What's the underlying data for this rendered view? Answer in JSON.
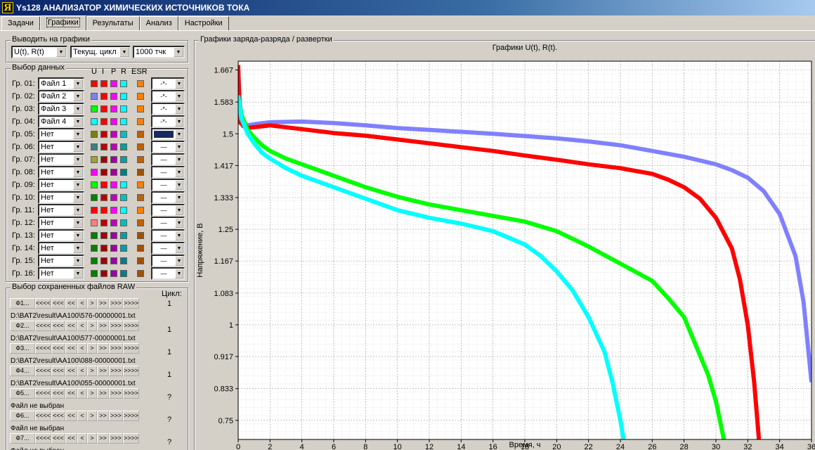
{
  "window": {
    "title": "Ys128 АНАЛИЗАТОР ХИМИЧЕСКИХ ИСТОЧНИКОВ ТОКА",
    "icon": "Я"
  },
  "tabs": [
    "Задачи",
    "Графики",
    "Результаты",
    "Анализ",
    "Настройки"
  ],
  "output": {
    "title": "Выводить на графики",
    "mode": "U(t), R(t)",
    "cycle": "Текущ. цикл",
    "points": "1000 тчк"
  },
  "data_select": {
    "title": "Выбор данных",
    "headers": [
      "U",
      "I",
      "P",
      "R",
      "ESR"
    ],
    "rows": [
      {
        "label": "Гр. 01:",
        "file": "Файл 1",
        "colors": [
          "#ff0000",
          "#ff0000",
          "#ff00ff",
          "#00ffff",
          "#ff8000"
        ],
        "style": "-*-"
      },
      {
        "label": "Гр. 02:",
        "file": "Файл 2",
        "colors": [
          "#8080ff",
          "#ff0000",
          "#ff00ff",
          "#00ffff",
          "#ff8000"
        ],
        "style": "-*-"
      },
      {
        "label": "Гр. 03:",
        "file": "Файл 3",
        "colors": [
          "#00ff00",
          "#ff0000",
          "#ff00ff",
          "#00ffff",
          "#ff8000"
        ],
        "style": "-*-"
      },
      {
        "label": "Гр. 04:",
        "file": "Файл 4",
        "colors": [
          "#00ffff",
          "#ff0000",
          "#ff00ff",
          "#00ffff",
          "#ff8000"
        ],
        "style": "-*-"
      },
      {
        "label": "Гр. 05:",
        "file": "Нет",
        "colors": [
          "#808000",
          "#c00000",
          "#c000c0",
          "#00c0c0",
          "#c06000"
        ],
        "style": "solid"
      },
      {
        "label": "Гр. 06:",
        "file": "Нет",
        "colors": [
          "#408080",
          "#c00000",
          "#c000c0",
          "#00a0a0",
          "#c06000"
        ],
        "style": "—"
      },
      {
        "label": "Гр. 07:",
        "file": "Нет",
        "colors": [
          "#a0a040",
          "#a00000",
          "#a000a0",
          "#00a0a0",
          "#c06000"
        ],
        "style": "—"
      },
      {
        "label": "Гр. 08:",
        "file": "Нет",
        "colors": [
          "#ff00ff",
          "#a00000",
          "#a000a0",
          "#008080",
          "#a05000"
        ],
        "style": "—"
      },
      {
        "label": "Гр. 09:",
        "file": "Нет",
        "colors": [
          "#00ff00",
          "#ff0000",
          "#ff00ff",
          "#00ffff",
          "#ff8000"
        ],
        "style": "—"
      },
      {
        "label": "Гр. 10:",
        "file": "Нет",
        "colors": [
          "#008000",
          "#c00000",
          "#c000c0",
          "#00c0c0",
          "#c06000"
        ],
        "style": "—"
      },
      {
        "label": "Гр. 11:",
        "file": "Нет",
        "colors": [
          "#ff0000",
          "#ff0000",
          "#ff00ff",
          "#00ffff",
          "#ff8000"
        ],
        "style": "—"
      },
      {
        "label": "Гр. 12:",
        "file": "Нет",
        "colors": [
          "#ff8080",
          "#c00000",
          "#c000c0",
          "#00c0c0",
          "#c06000"
        ],
        "style": "—"
      },
      {
        "label": "Гр. 13:",
        "file": "Нет",
        "colors": [
          "#008000",
          "#a00000",
          "#a000a0",
          "#00a0a0",
          "#a05000"
        ],
        "style": "—"
      },
      {
        "label": "Гр. 14:",
        "file": "Нет",
        "colors": [
          "#008000",
          "#a00000",
          "#a000a0",
          "#00a0a0",
          "#a05000"
        ],
        "style": "—"
      },
      {
        "label": "Гр. 15:",
        "file": "Нет",
        "colors": [
          "#008000",
          "#a00000",
          "#a000a0",
          "#008080",
          "#a05000"
        ],
        "style": "—"
      },
      {
        "label": "Гр. 16:",
        "file": "Нет",
        "colors": [
          "#008000",
          "#a00000",
          "#a000a0",
          "#008080",
          "#a05000"
        ],
        "style": "—"
      }
    ]
  },
  "raw_files": {
    "title": "Выбор сохраненных файлов RAW",
    "cycle_header": "Цикл:",
    "nav": [
      "<<<<",
      "<<<",
      "<<",
      "<",
      ">",
      ">>",
      ">>>",
      ">>>>"
    ],
    "files": [
      {
        "name": "Ф1...",
        "path": "D:\\BAT2\\result\\AA100\\576-00000001.txt",
        "cycle": "1"
      },
      {
        "name": "Ф2...",
        "path": "D:\\BAT2\\result\\AA100\\577-00000001.txt",
        "cycle": "1"
      },
      {
        "name": "Ф3...",
        "path": "D:\\BAT2\\result\\AA100\\088-00000001.txt",
        "cycle": "1"
      },
      {
        "name": "Ф4...",
        "path": "D:\\BAT2\\result\\AA100\\055-00000001.txt",
        "cycle": "1"
      },
      {
        "name": "Ф5...",
        "path": "Файл не выбран",
        "cycle": "?"
      },
      {
        "name": "Ф6...",
        "path": "Файл не выбран",
        "cycle": "?"
      },
      {
        "name": "Ф7...",
        "path": "Файл не выбран",
        "cycle": "?"
      }
    ]
  },
  "chart_panel": {
    "title": "Графики заряда-разряда / развертки"
  },
  "chart_data": {
    "type": "line",
    "title": "Графики U(t), R(t).",
    "xlabel": "Время, ч",
    "ylabel": "Напряжение, В",
    "xlim": [
      0,
      36
    ],
    "ylim": [
      0.7,
      1.69
    ],
    "xticks": [
      0,
      2,
      4,
      6,
      8,
      10,
      12,
      14,
      16,
      18,
      20,
      22,
      24,
      26,
      28,
      30,
      32,
      34,
      36
    ],
    "yticks": [
      {
        "v": 1.667,
        "label": "1.667"
      },
      {
        "v": 1.583,
        "label": "1.583"
      },
      {
        "v": 1.5,
        "label": "1.5"
      },
      {
        "v": 1.417,
        "label": "1.417"
      },
      {
        "v": 1.333,
        "label": "1.333"
      },
      {
        "v": 1.25,
        "label": "1.25"
      },
      {
        "v": 1.167,
        "label": "1.167"
      },
      {
        "v": 1.083,
        "label": "1.083"
      },
      {
        "v": 1.0,
        "label": "1"
      },
      {
        "v": 0.917,
        "label": "0.917"
      },
      {
        "v": 0.833,
        "label": "0.833"
      },
      {
        "v": 0.75,
        "label": "0.75"
      }
    ],
    "grid": true,
    "series": [
      {
        "color": "#8080ff",
        "points": [
          [
            0,
            1.67
          ],
          [
            0.1,
            1.58
          ],
          [
            0.3,
            1.52
          ],
          [
            1,
            1.525
          ],
          [
            2,
            1.53
          ],
          [
            4,
            1.532
          ],
          [
            6,
            1.528
          ],
          [
            8,
            1.522
          ],
          [
            10,
            1.515
          ],
          [
            12,
            1.51
          ],
          [
            14,
            1.505
          ],
          [
            16,
            1.5
          ],
          [
            18,
            1.494
          ],
          [
            20,
            1.488
          ],
          [
            22,
            1.48
          ],
          [
            24,
            1.47
          ],
          [
            26,
            1.455
          ],
          [
            28,
            1.44
          ],
          [
            30,
            1.42
          ],
          [
            31,
            1.405
          ],
          [
            32,
            1.385
          ],
          [
            33,
            1.35
          ],
          [
            34,
            1.29
          ],
          [
            35,
            1.18
          ],
          [
            35.5,
            1.06
          ],
          [
            36,
            0.85
          ]
        ]
      },
      {
        "color": "#ff0000",
        "points": [
          [
            0,
            1.68
          ],
          [
            0.1,
            1.53
          ],
          [
            0.5,
            1.515
          ],
          [
            2,
            1.522
          ],
          [
            4,
            1.512
          ],
          [
            6,
            1.502
          ],
          [
            8,
            1.495
          ],
          [
            10,
            1.485
          ],
          [
            12,
            1.475
          ],
          [
            14,
            1.465
          ],
          [
            16,
            1.455
          ],
          [
            18,
            1.443
          ],
          [
            20,
            1.432
          ],
          [
            22,
            1.42
          ],
          [
            24,
            1.41
          ],
          [
            26,
            1.395
          ],
          [
            27,
            1.38
          ],
          [
            28,
            1.36
          ],
          [
            29,
            1.33
          ],
          [
            30,
            1.28
          ],
          [
            31,
            1.2
          ],
          [
            31.5,
            1.12
          ],
          [
            32,
            1.0
          ],
          [
            32.4,
            0.85
          ],
          [
            32.7,
            0.7
          ]
        ]
      },
      {
        "color": "#00ff00",
        "points": [
          [
            0,
            1.6
          ],
          [
            0.2,
            1.55
          ],
          [
            0.6,
            1.51
          ],
          [
            1,
            1.49
          ],
          [
            1.5,
            1.47
          ],
          [
            2,
            1.455
          ],
          [
            3,
            1.435
          ],
          [
            4,
            1.42
          ],
          [
            6,
            1.39
          ],
          [
            8,
            1.36
          ],
          [
            10,
            1.335
          ],
          [
            12,
            1.315
          ],
          [
            14,
            1.3
          ],
          [
            16,
            1.285
          ],
          [
            18,
            1.27
          ],
          [
            20,
            1.245
          ],
          [
            22,
            1.205
          ],
          [
            24,
            1.16
          ],
          [
            26,
            1.115
          ],
          [
            27,
            1.07
          ],
          [
            28,
            1.02
          ],
          [
            28.5,
            0.97
          ],
          [
            29,
            0.92
          ],
          [
            29.5,
            0.87
          ],
          [
            30,
            0.8
          ],
          [
            30.5,
            0.7
          ]
        ]
      },
      {
        "color": "#00ffff",
        "points": [
          [
            0,
            1.6
          ],
          [
            0.2,
            1.54
          ],
          [
            0.6,
            1.5
          ],
          [
            1,
            1.475
          ],
          [
            1.5,
            1.45
          ],
          [
            2,
            1.435
          ],
          [
            3,
            1.41
          ],
          [
            4,
            1.39
          ],
          [
            6,
            1.36
          ],
          [
            8,
            1.33
          ],
          [
            10,
            1.3
          ],
          [
            12,
            1.28
          ],
          [
            14,
            1.265
          ],
          [
            16,
            1.245
          ],
          [
            18,
            1.21
          ],
          [
            19,
            1.18
          ],
          [
            20,
            1.14
          ],
          [
            21,
            1.09
          ],
          [
            22,
            1.02
          ],
          [
            23,
            0.93
          ],
          [
            23.5,
            0.85
          ],
          [
            24,
            0.75
          ],
          [
            24.2,
            0.7
          ]
        ]
      }
    ]
  }
}
